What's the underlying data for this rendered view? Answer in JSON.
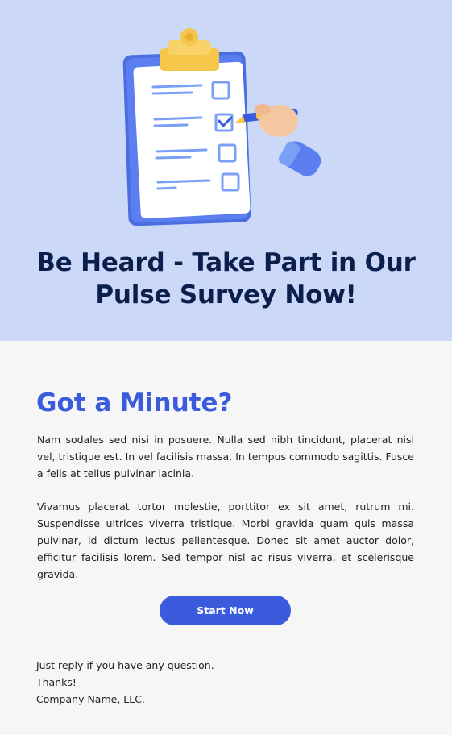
{
  "hero": {
    "title_line1": "Be Heard - Take Part in Our",
    "title_line2": "Pulse Survey Now!"
  },
  "body": {
    "heading": "Got a Minute?",
    "paragraph1": "Nam sodales sed nisi in posuere. Nulla sed nibh tincidunt, placerat nisl vel, tristique est. In vel facilisis massa. In tempus commodo sagittis. Fusce a felis at tellus pulvinar lacinia.",
    "paragraph2": "Vivamus placerat tortor molestie, porttitor ex sit amet, rutrum mi. Suspendisse ultrices viverra tristique. Morbi gravida quam quis massa pulvinar, id dictum lectus pellentesque. Donec sit amet auctor dolor, efficitur facilisis lorem. Sed tempor nisl ac risus viverra, et scelerisque gravida."
  },
  "cta": {
    "label": "Start Now"
  },
  "signoff": {
    "line1": "Just reply if you have any question.",
    "line2": "Thanks!",
    "line3": "Company Name, LLC."
  },
  "colors": {
    "hero_bg": "#cbd8f7",
    "accent": "#3a5bdc",
    "title_dark": "#0b1f4d",
    "page_bg": "#f6f6f6"
  },
  "icons": {
    "hero_illustration": "clipboard-checklist-icon"
  }
}
